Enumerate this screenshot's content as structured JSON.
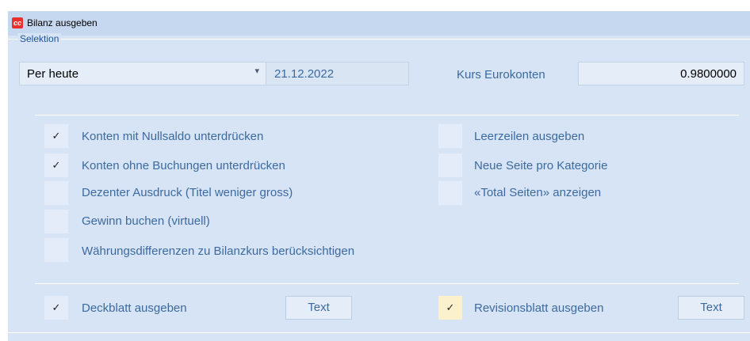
{
  "window": {
    "title": "Bilanz ausgeben",
    "icon": "app-logo-icon",
    "icon_glyph": "cc"
  },
  "selection": {
    "group_label": "Selektion",
    "period_select": {
      "value": "Per heute",
      "arrow": "▾"
    },
    "date": "21.12.2022",
    "rate_label": "Kurs Eurokonten",
    "rate_value": "0.9800000"
  },
  "options_left": [
    {
      "label": "Konten mit Nullsaldo unterdrücken",
      "checked": true
    },
    {
      "label": "Konten ohne Buchungen unterdrücken",
      "checked": true
    },
    {
      "label": "Dezenter Ausdruck (Titel weniger gross)",
      "checked": false
    },
    {
      "label": "Gewinn buchen (virtuell)",
      "checked": false
    },
    {
      "label": "Währungsdifferenzen zu Bilanzkurs berücksichtigen",
      "checked": false
    }
  ],
  "options_right": [
    {
      "label": "Leerzeilen ausgeben",
      "checked": false
    },
    {
      "label": "Neue Seite pro Kategorie",
      "checked": false
    },
    {
      "label": "«Total Seiten» anzeigen",
      "checked": false
    }
  ],
  "footer": {
    "cover": {
      "label": "Deckblatt ausgeben",
      "checked": true,
      "button": "Text"
    },
    "revision": {
      "label": "Revisionsblatt ausgeben",
      "checked": true,
      "button": "Text"
    }
  },
  "check_glyph": "✓",
  "colors": {
    "label_blue": "#3d6a9e",
    "panel": "#d6e4f5",
    "highlight_yellow": "#fbf2cd"
  }
}
